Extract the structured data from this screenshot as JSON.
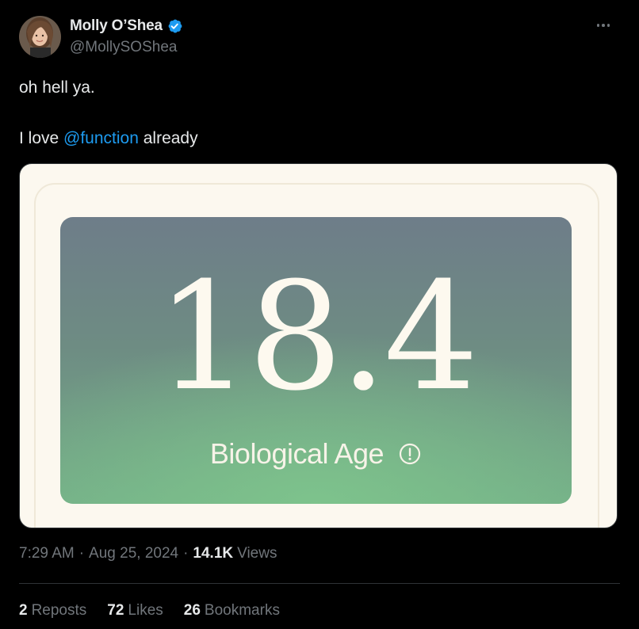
{
  "author": {
    "display_name": "Molly O’Shea",
    "handle": "@MollySOShea",
    "verified": true,
    "verified_color": "#1d9bf0"
  },
  "menu_icon": "more-horizontal-icon",
  "tweet": {
    "line1": "oh hell ya.",
    "line2_prefix": "I love ",
    "mention": "@function",
    "line2_suffix": " already"
  },
  "media": {
    "age_value": "18.4",
    "age_label": "Biological Age",
    "info_icon": "info-circle-icon"
  },
  "meta": {
    "time": "7:29 AM",
    "separator": "·",
    "date": "Aug 25, 2024",
    "views_count": "14.1K",
    "views_label": "Views"
  },
  "stats": {
    "reposts_count": "2",
    "reposts_label": "Reposts",
    "likes_count": "72",
    "likes_label": "Likes",
    "bookmarks_count": "26",
    "bookmarks_label": "Bookmarks"
  },
  "colors": {
    "background": "#000000",
    "text_primary": "#e7e9ea",
    "text_secondary": "#71767b",
    "link": "#1d9bf0",
    "card_bg": "#fcf8ef"
  }
}
